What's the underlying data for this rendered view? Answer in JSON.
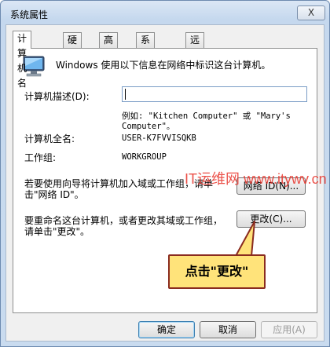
{
  "window": {
    "title": "系统属性",
    "close_label": "X"
  },
  "tabs": [
    {
      "label": "计算机名"
    },
    {
      "label": "硬件"
    },
    {
      "label": "高级"
    },
    {
      "label": "系统保护"
    },
    {
      "label": "远程"
    }
  ],
  "panel": {
    "intro": "Windows 使用以下信息在网络中标识这台计算机。",
    "description_label": "计算机描述(D):",
    "description_value": "",
    "example_line1": "例如: \"Kitchen Computer\" 或 \"Mary's",
    "example_line2": "Computer\"。",
    "fullname_label": "计算机全名:",
    "fullname_value": "USER-K7FVVISQKB",
    "workgroup_label": "工作组:",
    "workgroup_value": "WORKGROUP",
    "wizard_text_line1": "若要使用向导将计算机加入域或工作组，请单",
    "wizard_text_line2": "击\"网络 ID\"。",
    "network_id_button": "网络 ID(N)...",
    "rename_text_line1": "要重命名这台计算机，或者更改其域或工作组，",
    "rename_text_line2": "请单击\"更改\"。",
    "change_button": "更改(C)..."
  },
  "footer": {
    "ok_button": "确定",
    "cancel_button": "取消",
    "apply_button": "应用(A)"
  },
  "annotation": {
    "callout_text": "点击\"更改\"",
    "watermark_text": "IT运维网 www.itywv.cn"
  },
  "colors": {
    "callout_fill": "#ffe37a",
    "callout_border": "#8a2b1f",
    "watermark": "#e8332a"
  }
}
